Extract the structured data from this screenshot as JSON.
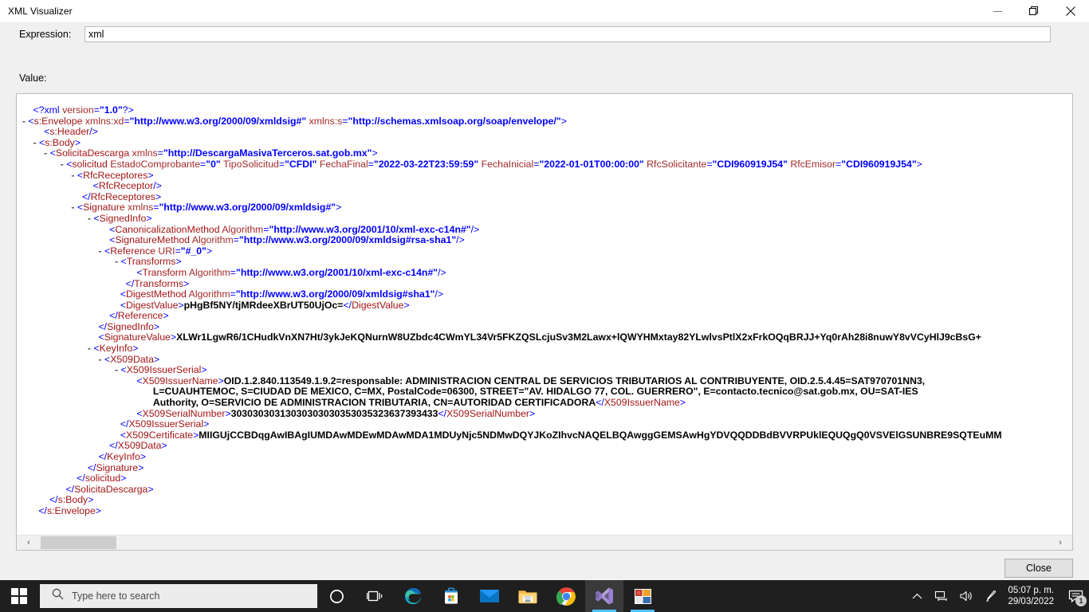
{
  "window": {
    "title": "XML Visualizer",
    "minimize_label": "Minimize",
    "restore_label": "Restore",
    "close_label": "Close"
  },
  "form": {
    "expression_label": "Expression:",
    "expression_value": "xml",
    "expression_placeholder": "",
    "value_label": "Value:"
  },
  "buttons": {
    "close": "Close"
  },
  "scrollbar": {
    "left_arrow": "‹",
    "right_arrow": "›"
  },
  "xml": {
    "lines": [
      {
        "indent": 3,
        "marker": "",
        "content": "<?xml version=\"1.0\"?>"
      },
      {
        "indent": 2,
        "marker": "-",
        "content": "<s:Envelope xmlns:xd=\"http://www.w3.org/2000/09/xmldsig#\" xmlns:s=\"http://schemas.xmlsoap.org/soap/envelope/\">"
      },
      {
        "indent": 5,
        "marker": "",
        "content": "<s:Header/>"
      },
      {
        "indent": 4,
        "marker": "-",
        "content": "<s:Body>"
      },
      {
        "indent": 6,
        "marker": "-",
        "content": "<SolicitaDescarga xmlns=\"http://DescargaMasivaTerceros.sat.gob.mx\">"
      },
      {
        "indent": 9,
        "marker": "-",
        "content": "<solicitud EstadoComprobante=\"0\" TipoSolicitud=\"CFDI\" FechaFinal=\"2022-03-22T23:59:59\" FechaInicial=\"2022-01-01T00:00:00\" RfcSolicitante=\"CDI960919J54\" RfcEmisor=\"CDI960919J54\">"
      },
      {
        "indent": 11,
        "marker": "-",
        "content": "<RfcReceptores>"
      },
      {
        "indent": 14,
        "marker": "",
        "content": "<RfcReceptor/>"
      },
      {
        "indent": 12,
        "marker": "",
        "content": "</RfcReceptores>"
      },
      {
        "indent": 11,
        "marker": "-",
        "content": "<Signature xmlns=\"http://www.w3.org/2000/09/xmldsig#\">"
      },
      {
        "indent": 14,
        "marker": "-",
        "content": "<SignedInfo>"
      },
      {
        "indent": 17,
        "marker": "",
        "content": "<CanonicalizationMethod Algorithm=\"http://www.w3.org/2001/10/xml-exc-c14n#\"/>"
      },
      {
        "indent": 17,
        "marker": "",
        "content": "<SignatureMethod Algorithm=\"http://www.w3.org/2000/09/xmldsig#rsa-sha1\"/>"
      },
      {
        "indent": 16,
        "marker": "-",
        "content": "<Reference URI=\"#_0\">"
      },
      {
        "indent": 19,
        "marker": "-",
        "content": "<Transforms>"
      },
      {
        "indent": 22,
        "marker": "",
        "content": "<Transform Algorithm=\"http://www.w3.org/2001/10/xml-exc-c14n#\"/>"
      },
      {
        "indent": 20,
        "marker": "",
        "content": "</Transforms>"
      },
      {
        "indent": 19,
        "marker": "",
        "content": "<DigestMethod Algorithm=\"http://www.w3.org/2000/09/xmldsig#sha1\"/>"
      },
      {
        "indent": 19,
        "marker": "",
        "content": "<DigestValue>pHgBf5NY/tjMRdeeXBrUT50UjOc=</DigestValue>"
      },
      {
        "indent": 17,
        "marker": "",
        "content": "</Reference>"
      },
      {
        "indent": 15,
        "marker": "",
        "content": "</SignedInfo>"
      },
      {
        "indent": 15,
        "marker": "",
        "content": "<SignatureValue>XLWr1LgwR6/1CHudkVnXN7Ht/3ykJeKQNurnW8UZbdc4CWmYL34Vr5FKZQSLcjuSv3M2Lawx+lQWYHMxtay82YLwlvsPtlX2xFrkOQqBRJJ+Yq0rAh28i8nuwY8vVCyHlJ9cBsG+"
      },
      {
        "indent": 14,
        "marker": "-",
        "content": "<KeyInfo>"
      },
      {
        "indent": 16,
        "marker": "-",
        "content": "<X509Data>"
      },
      {
        "indent": 19,
        "marker": "-",
        "content": "<X509IssuerSerial>"
      },
      {
        "indent": 22,
        "marker": "",
        "content": "<X509IssuerName>OID.1.2.840.113549.1.9.2=responsable: ADMINISTRACION CENTRAL DE SERVICIOS TRIBUTARIOS AL CONTRIBUYENTE, OID.2.5.4.45=SAT970701NN3,"
      },
      {
        "indent": 25,
        "marker": "",
        "content": "L=CUAUHTEMOC, S=CIUDAD DE MEXICO, C=MX, PostalCode=06300, STREET=\"AV. HIDALGO 77, COL. GUERRERO\", E=contacto.tecnico@sat.gob.mx, OU=SAT-IES"
      },
      {
        "indent": 25,
        "marker": "",
        "content": "Authority, O=SERVICIO DE ADMINISTRACION TRIBUTARIA, CN=AUTORIDAD CERTIFICADORA</X509IssuerName>"
      },
      {
        "indent": 22,
        "marker": "",
        "content": "<X509SerialNumber>30303030313030303030353035323637393433</X509SerialNumber>"
      },
      {
        "indent": 19,
        "marker": "",
        "content": "</X509IssuerSerial>"
      },
      {
        "indent": 19,
        "marker": "",
        "content": "<X509Certificate>MIIGUjCCBDqgAwIBAgIUMDAwMDEwMDAwMDA1MDUyNjc5NDMwDQYJKoZIhvcNAQELBQAwggGEMSAwHgYDVQQDDBdBVVRPUklEQUQgQ0VSVElGSUNBRE9SQTEuMM"
      },
      {
        "indent": 17,
        "marker": "",
        "content": "</X509Data>"
      },
      {
        "indent": 15,
        "marker": "",
        "content": "</KeyInfo>"
      },
      {
        "indent": 13,
        "marker": "",
        "content": "</Signature>"
      },
      {
        "indent": 11,
        "marker": "",
        "content": "</solicitud>"
      },
      {
        "indent": 9,
        "marker": "",
        "content": "</SolicitaDescarga>"
      },
      {
        "indent": 6,
        "marker": "",
        "content": "</s:Body>"
      },
      {
        "indent": 4,
        "marker": "",
        "content": "</s:Envelope>"
      }
    ]
  },
  "taskbar": {
    "start_label": "Start",
    "search_placeholder": "Type here to search",
    "cortana_label": "Cortana",
    "taskview_label": "Task View",
    "apps": [
      {
        "name": "edge-icon",
        "label": "Microsoft Edge",
        "running": false
      },
      {
        "name": "store-icon",
        "label": "Microsoft Store",
        "running": false
      },
      {
        "name": "mail-icon",
        "label": "Mail",
        "running": false
      },
      {
        "name": "file-explorer-icon",
        "label": "File Explorer",
        "running": false
      },
      {
        "name": "chrome-icon",
        "label": "Google Chrome",
        "running": false
      },
      {
        "name": "visual-studio-icon",
        "label": "Visual Studio",
        "running": true
      },
      {
        "name": "powerpoint-icon",
        "label": "Microsoft PowerPoint",
        "running": true
      }
    ],
    "tray": {
      "show_hidden_label": "Show hidden icons",
      "network_label": "Network",
      "volume_label": "Volume",
      "pen_label": "Windows Ink Workspace",
      "time": "05:07 p. m.",
      "date": "29/03/2022",
      "notification_count": "1"
    }
  },
  "colors": {
    "tag": "#a31515",
    "attribute": "#a52a2a",
    "value": "#0000ff",
    "punctuation": "#0000ff",
    "text": "#000000",
    "accent": "#0078d7",
    "taskbar_bg": "#1f1f1f"
  }
}
